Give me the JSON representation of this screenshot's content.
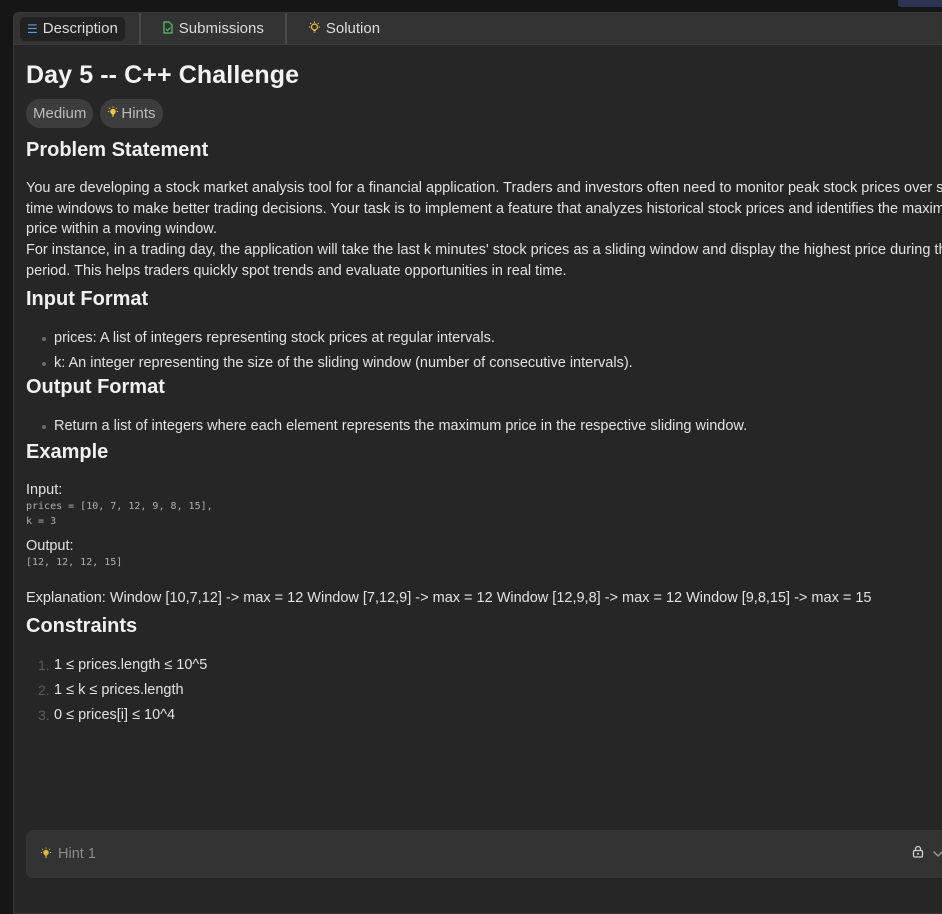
{
  "tabs": [
    {
      "label": "Description",
      "icon": "list-icon"
    },
    {
      "label": "Submissions",
      "icon": "document-check-icon"
    },
    {
      "label": "Solution",
      "icon": "lightbulb-icon"
    }
  ],
  "problem": {
    "title": "Day 5 -- C++ Challenge",
    "difficulty": "Medium",
    "hints_label": "Hints"
  },
  "statement": {
    "heading": "Problem Statement",
    "lines": [
      "You are developing a stock market analysis tool for a financial application. Traders and investors often need to monitor peak stock prices over specific",
      "time windows to make better trading decisions. Your task is to implement a feature that analyzes historical stock prices and identifies the maximum",
      "price within a moving window.",
      "For instance, in a trading day, the application will take the last k minutes' stock prices as a sliding window and display the highest price during that",
      "period. This helps traders quickly spot trends and evaluate opportunities in real time."
    ]
  },
  "input_format": {
    "heading": "Input Format",
    "items": [
      "prices: A list of integers representing stock prices at regular intervals.",
      "k: An integer representing the size of the sliding window (number of consecutive intervals)."
    ]
  },
  "output_format": {
    "heading": "Output Format",
    "items": [
      "Return a list of integers where each element represents the maximum price in the respective sliding window."
    ]
  },
  "example": {
    "heading": "Example",
    "input_label": "Input:",
    "input_line1": "prices = [10, 7, 12, 9, 8, 15],",
    "input_line2": "k = 3",
    "output_label": "Output:",
    "output_line": "[12, 12, 12, 15]",
    "explanation": "Explanation: Window [10,7,12] -> max = 12 Window [7,12,9] -> max = 12 Window [12,9,8] -> max = 12 Window [9,8,15] -> max = 15"
  },
  "constraints": {
    "heading": "Constraints",
    "items": [
      {
        "num": "1.",
        "text": "1 ≤ prices.length ≤ 10^5"
      },
      {
        "num": "2.",
        "text": "1 ≤ k ≤ prices.length"
      },
      {
        "num": "3.",
        "text": "0 ≤ prices[i] ≤ 10^4"
      }
    ]
  },
  "hint": {
    "label": "Hint 1",
    "locked": true
  },
  "colors": {
    "background": "#262626",
    "tabbar": "#333333",
    "badge": "#3d3d3d",
    "bulb": "#f0c94a"
  }
}
